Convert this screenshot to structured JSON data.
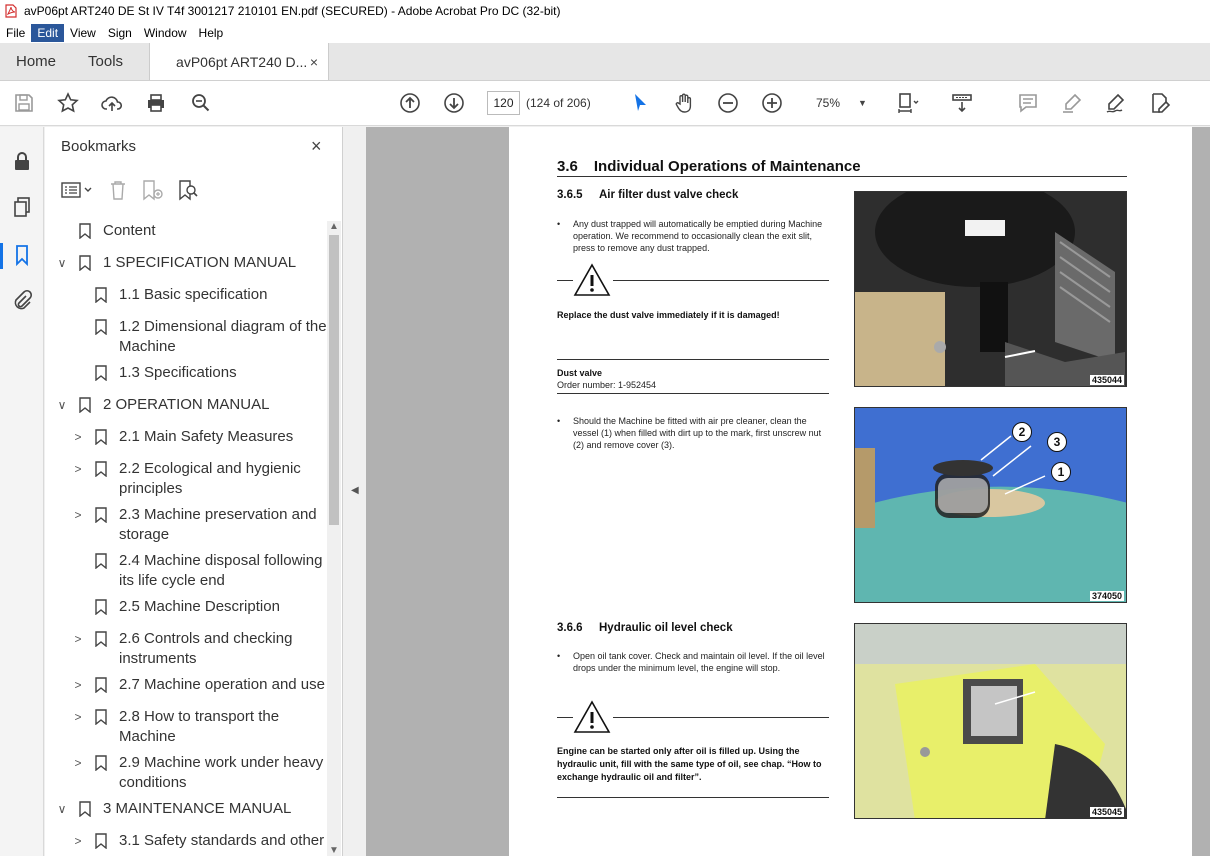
{
  "window": {
    "title": "avP06pt ART240 DE St IV T4f 3001217 210101 EN.pdf (SECURED) - Adobe Acrobat Pro DC (32-bit)"
  },
  "menu": [
    "File",
    "Edit",
    "View",
    "Sign",
    "Window",
    "Help"
  ],
  "tabs": {
    "home": "Home",
    "tools": "Tools",
    "doc": "avP06pt ART240 D...",
    "close": "×"
  },
  "toolbar": {
    "page_current": "120",
    "page_count": "(124 of 206)",
    "zoom": "75%",
    "zoom_caret": "▼"
  },
  "bookmarks": {
    "title": "Bookmarks",
    "close": "×",
    "items": [
      {
        "label": "Content",
        "level": 0,
        "chevron": ""
      },
      {
        "label": "1 SPECIFICATION MANUAL",
        "level": 0,
        "chevron": "∨"
      },
      {
        "label": "1.1 Basic specification",
        "level": 1,
        "chevron": ""
      },
      {
        "label": "1.2 Dimensional diagram of the Machine",
        "level": 1,
        "chevron": ""
      },
      {
        "label": "1.3 Specifications",
        "level": 1,
        "chevron": ""
      },
      {
        "label": "2 OPERATION MANUAL",
        "level": 0,
        "chevron": "∨"
      },
      {
        "label": "2.1 Main Safety Measures",
        "level": 1,
        "chevron": ">"
      },
      {
        "label": "2.2 Ecological and hygienic principles",
        "level": 1,
        "chevron": ">"
      },
      {
        "label": "2.3 Machine preservation and storage",
        "level": 1,
        "chevron": ">"
      },
      {
        "label": "2.4 Machine disposal following its life cycle end",
        "level": 1,
        "chevron": ""
      },
      {
        "label": "2.5 Machine Description",
        "level": 1,
        "chevron": ""
      },
      {
        "label": "2.6 Controls and checking instruments",
        "level": 1,
        "chevron": ">"
      },
      {
        "label": "2.7 Machine operation and use",
        "level": 1,
        "chevron": ">"
      },
      {
        "label": "2.8 How to transport the Machine",
        "level": 1,
        "chevron": ">"
      },
      {
        "label": "2.9 Machine work under heavy conditions",
        "level": 1,
        "chevron": ">"
      },
      {
        "label": "3 MAINTENANCE MANUAL",
        "level": 0,
        "chevron": "∨"
      },
      {
        "label": "3.1 Safety standards and other",
        "level": 1,
        "chevron": ">"
      }
    ]
  },
  "doc": {
    "section_num": "3.6",
    "section_title": "Individual Operations of Maintenance",
    "sub1_num": "3.6.5",
    "sub1_title": "Air filter dust valve check",
    "sub1_text": "Any dust trapped will automatically be emptied during Machine operation. We recommend to occasionally clean the exit slit, press to remove any dust trapped.",
    "warn1": "Replace the dust valve immediately if it is damaged!",
    "part_name": "Dust valve",
    "part_order": "Order number: 1-952454",
    "sub1_text2": "Should the Machine be fitted with air pre cleaner, clean the vessel (1) when filled with dirt up to the mark, first unscrew nut (2) and remove cover (3).",
    "sub2_num": "3.6.6",
    "sub2_title": "Hydraulic oil level check",
    "sub2_text": "Open oil tank cover. Check and maintain oil level. If the oil level drops under the minimum level, the engine will stop.",
    "warn2": "Engine can be started only after oil is filled up. Using the hydraulic unit, fill with the same type of oil, see chap. “How to exchange hydraulic oil and filter”.",
    "bullet": "•",
    "photo1_id": "435044",
    "photo2_id": "374050",
    "photo3_id": "435045",
    "callouts": [
      "2",
      "3",
      "1"
    ]
  }
}
